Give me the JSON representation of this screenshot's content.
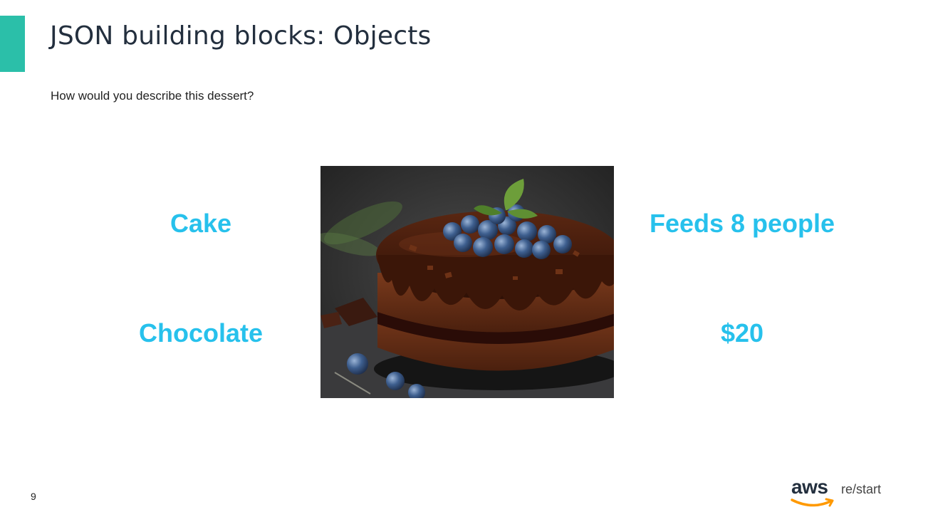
{
  "slide": {
    "title": "JSON building blocks: Objects",
    "subtitle": "How would you describe this dessert?",
    "page_number": "9"
  },
  "attributes": {
    "type": "Cake",
    "flavor": "Chocolate",
    "servings": "Feeds 8 people",
    "price": "$20"
  },
  "logo": {
    "brand": "aws",
    "product": "re/start"
  },
  "colors": {
    "accent_bar": "#2bbfa9",
    "attribute_text": "#27c1ec",
    "title_text": "#232f3e",
    "aws_smile": "#ff9900"
  }
}
